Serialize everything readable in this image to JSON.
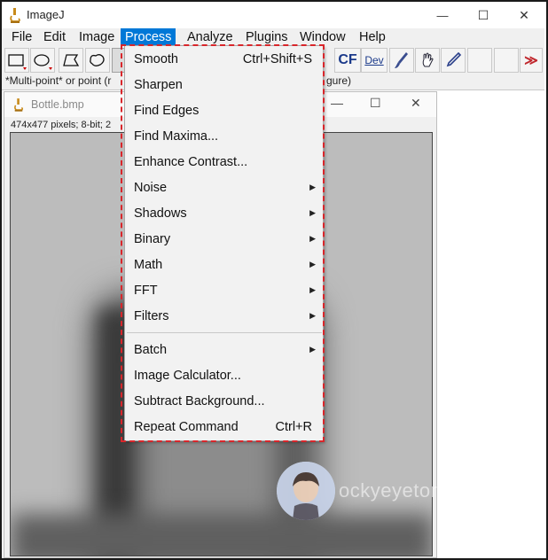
{
  "app": {
    "title": "ImageJ",
    "icon": "microscope-icon"
  },
  "window_controls": {
    "minimize": "—",
    "maximize": "☐",
    "close": "✕"
  },
  "menubar": {
    "items": [
      {
        "label": "File",
        "active": false
      },
      {
        "label": "Edit",
        "active": false
      },
      {
        "label": "Image",
        "active": false
      },
      {
        "label": "Process",
        "active": true
      },
      {
        "label": "Analyze",
        "active": false
      },
      {
        "label": "Plugins",
        "active": false
      },
      {
        "label": "Window",
        "active": false
      },
      {
        "label": "Help",
        "active": false
      }
    ],
    "active_color": "#0078d7"
  },
  "toolbar": {
    "tools": [
      "rectangle-tool",
      "oval-tool",
      "polygon-tool",
      "freehand-tool",
      "cf-tool",
      "dev-tool",
      "brush-tool",
      "hand-tool",
      "dropper-tool",
      "more-tools"
    ],
    "cf_label": "CF",
    "dev_label": "Dev"
  },
  "status_bar": {
    "left": "*Multi-point* or point (r",
    "right": "gure)"
  },
  "image_window": {
    "title": "Bottle.bmp",
    "info": "474x477 pixels; 8-bit; 2"
  },
  "process_menu": {
    "items": [
      {
        "label": "Smooth",
        "shortcut": "Ctrl+Shift+S",
        "submenu": false
      },
      {
        "label": "Sharpen",
        "shortcut": "",
        "submenu": false
      },
      {
        "label": "Find Edges",
        "shortcut": "",
        "submenu": false
      },
      {
        "label": "Find Maxima...",
        "shortcut": "",
        "submenu": false
      },
      {
        "label": "Enhance Contrast...",
        "shortcut": "",
        "submenu": false
      },
      {
        "label": "Noise",
        "shortcut": "",
        "submenu": true
      },
      {
        "label": "Shadows",
        "shortcut": "",
        "submenu": true
      },
      {
        "label": "Binary",
        "shortcut": "",
        "submenu": true
      },
      {
        "label": "Math",
        "shortcut": "",
        "submenu": true
      },
      {
        "label": "FFT",
        "shortcut": "",
        "submenu": true
      },
      {
        "label": "Filters",
        "shortcut": "",
        "submenu": true
      },
      {
        "label": "Batch",
        "shortcut": "",
        "submenu": true
      },
      {
        "label": "Image Calculator...",
        "shortcut": "",
        "submenu": false
      },
      {
        "label": "Subtract Background...",
        "shortcut": "",
        "submenu": false
      },
      {
        "label": "Repeat Command",
        "shortcut": "Ctrl+R",
        "submenu": false
      }
    ],
    "highlight_color": "#d9262b"
  },
  "watermark": {
    "text": "ockyeyetory.com"
  }
}
